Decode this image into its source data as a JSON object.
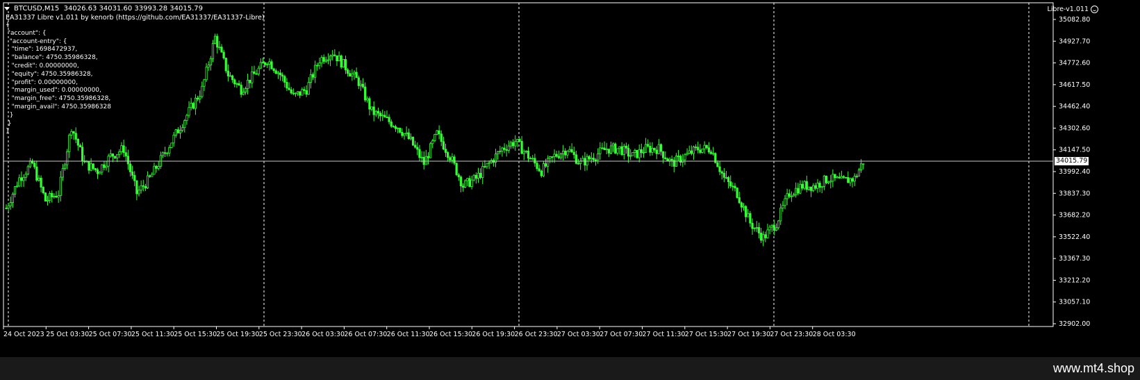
{
  "header": {
    "symbol": "BTCUSD,M15",
    "ohlc": "34026.63 34031.60 33993.28 34015.79",
    "subtitle": "EA31337 Libre v1.011 by kenorb (https://github.com/EA31337/EA31337-Libre)"
  },
  "json_text": [
    "{",
    " \"account\": {",
    "  \"account-entry\": {",
    "   \"time\": 1698472937,",
    "   \"balance\": 4750.35986328,",
    "   \"credit\": 0.00000000,",
    "   \"equity\": 4750.35986328,",
    "   \"profit\": 0.00000000,",
    "   \"margin_used\": 0.00000000,",
    "   \"margin_free\": 4750.35986328,",
    "   \"margin_avail\": 4750.35986328",
    "  }",
    " }",
    "}"
  ],
  "tag": {
    "label": "Libre-v1.011",
    "icon": "smiley-icon"
  },
  "current_price": "34015.79",
  "footer": {
    "brand": "www.mt4.shop"
  },
  "colors": {
    "background": "#000000",
    "candle": "#33ff33",
    "grid": "#ffffff",
    "text": "#ffffff"
  },
  "chart_data": {
    "type": "candlestick",
    "y_ticks": [
      "35082.80",
      "34927.70",
      "34772.60",
      "34617.50",
      "34462.40",
      "34302.60",
      "34147.50",
      "33992.40",
      "33837.30",
      "33682.20",
      "33522.40",
      "33367.30",
      "33212.20",
      "33057.10",
      "32902.00"
    ],
    "x_ticks": [
      "24 Oct 2023",
      "25 Oct 03:30",
      "25 Oct 07:30",
      "25 Oct 11:30",
      "25 Oct 15:30",
      "25 Oct 19:30",
      "25 Oct 23:30",
      "26 Oct 03:30",
      "26 Oct 07:30",
      "26 Oct 11:30",
      "26 Oct 15:30",
      "26 Oct 19:30",
      "26 Oct 23:30",
      "27 Oct 03:30",
      "27 Oct 07:30",
      "27 Oct 11:30",
      "27 Oct 15:30",
      "27 Oct 19:30",
      "27 Oct 23:30",
      "28 Oct 03:30"
    ],
    "ylim": [
      32902.0,
      35082.8
    ],
    "price_line": 34015.79,
    "day_separator_labels": [
      "24 Oct 2023",
      "25 Oct 23:30",
      "26 Oct 23:30",
      "27 Oct 23:30"
    ],
    "close_path": [
      [
        0,
        33700
      ],
      [
        3,
        33900
      ],
      [
        6,
        34000
      ],
      [
        9,
        33750
      ],
      [
        12,
        33800
      ],
      [
        15,
        34250
      ],
      [
        18,
        34000
      ],
      [
        21,
        33950
      ],
      [
        24,
        34050
      ],
      [
        27,
        34100
      ],
      [
        30,
        33800
      ],
      [
        33,
        33900
      ],
      [
        36,
        34050
      ],
      [
        39,
        34200
      ],
      [
        42,
        34350
      ],
      [
        45,
        34500
      ],
      [
        48,
        34850
      ],
      [
        51,
        34600
      ],
      [
        54,
        34500
      ],
      [
        57,
        34600
      ],
      [
        60,
        34700
      ],
      [
        63,
        34600
      ],
      [
        66,
        34450
      ],
      [
        69,
        34500
      ],
      [
        72,
        34700
      ],
      [
        75,
        34750
      ],
      [
        78,
        34650
      ],
      [
        81,
        34550
      ],
      [
        84,
        34350
      ],
      [
        87,
        34300
      ],
      [
        90,
        34250
      ],
      [
        93,
        34150
      ],
      [
        96,
        34000
      ],
      [
        99,
        34200
      ],
      [
        102,
        34050
      ],
      [
        105,
        33850
      ],
      [
        108,
        33900
      ],
      [
        111,
        34000
      ],
      [
        114,
        34100
      ],
      [
        117,
        34150
      ],
      [
        120,
        34050
      ],
      [
        123,
        33950
      ],
      [
        126,
        34050
      ],
      [
        129,
        34100
      ],
      [
        132,
        34000
      ],
      [
        135,
        34050
      ],
      [
        138,
        34100
      ],
      [
        141,
        34100
      ],
      [
        144,
        34050
      ],
      [
        147,
        34100
      ],
      [
        150,
        34100
      ],
      [
        153,
        34000
      ],
      [
        156,
        34050
      ],
      [
        159,
        34100
      ],
      [
        162,
        34100
      ],
      [
        165,
        33900
      ],
      [
        168,
        33800
      ],
      [
        171,
        33600
      ],
      [
        174,
        33500
      ],
      [
        177,
        33600
      ],
      [
        180,
        33800
      ],
      [
        183,
        33850
      ],
      [
        186,
        33850
      ],
      [
        189,
        33900
      ],
      [
        192,
        33880
      ],
      [
        195,
        33900
      ],
      [
        197,
        34015
      ]
    ],
    "x_max": 240
  }
}
